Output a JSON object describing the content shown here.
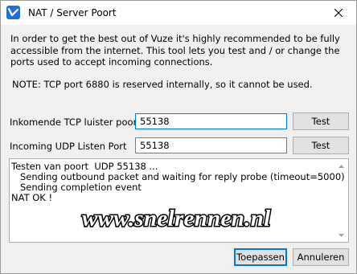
{
  "window": {
    "title": "NAT / Server Poort",
    "close_icon": "close-icon",
    "app_icon": "vuze-icon"
  },
  "intro_text": "In order to get the best out of Vuze it's highly recommended to be fully accessible from the internet. This tool lets you test and / or change the ports used to accept incoming connections.",
  "note_text": "NOTE: TCP port 6880 is reserved internally, so it cannot be used.",
  "tcp": {
    "label": "Inkomende TCP luister poort",
    "value": "55138",
    "test_label": "Test"
  },
  "udp": {
    "label": "Incoming UDP Listen Port",
    "value": "55138",
    "test_label": "Test"
  },
  "log": {
    "lines": [
      "Testen van poort  UDP 55138 ...",
      "   Sending outbound packet and waiting for reply probe (timeout=5000)",
      "   Sending completion event",
      "NAT OK !"
    ]
  },
  "watermark": {
    "text": "www.snelrennen.nl"
  },
  "buttons": {
    "apply": "Toepassen",
    "cancel": "Annuleren"
  },
  "colors": {
    "accent": "#0078d7",
    "watermark_fill": "#ffffff",
    "watermark_stroke": "#000000"
  }
}
